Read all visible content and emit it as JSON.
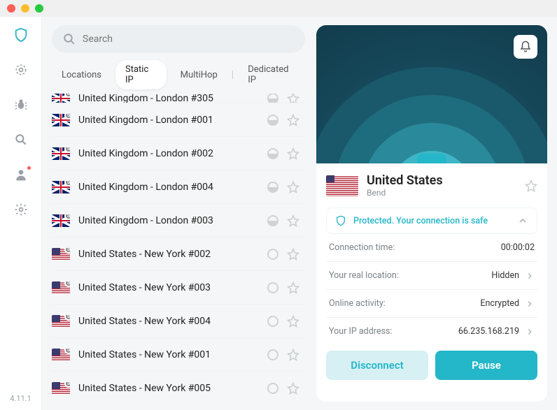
{
  "version": "4.11.1",
  "search": {
    "placeholder": "Search"
  },
  "tabs": {
    "items": [
      "Locations",
      "Static IP",
      "MultiHop",
      "Dedicated IP"
    ],
    "activeIndex": 1
  },
  "locations": [
    {
      "name": "United Kingdom - London #305",
      "flag": "uk",
      "load": "half",
      "cut": true
    },
    {
      "name": "United Kingdom - London #001",
      "flag": "uk",
      "load": "half"
    },
    {
      "name": "United Kingdom - London #002",
      "flag": "uk",
      "load": "half"
    },
    {
      "name": "United Kingdom - London #004",
      "flag": "uk",
      "load": "half"
    },
    {
      "name": "United Kingdom - London #003",
      "flag": "uk",
      "load": "half"
    },
    {
      "name": "United States - New York #002",
      "flag": "us",
      "load": "empty"
    },
    {
      "name": "United States - New York #003",
      "flag": "us",
      "load": "empty"
    },
    {
      "name": "United States - New York #004",
      "flag": "us",
      "load": "empty"
    },
    {
      "name": "United States - New York #001",
      "flag": "us",
      "load": "empty"
    },
    {
      "name": "United States - New York #005",
      "flag": "us",
      "load": "empty"
    }
  ],
  "current": {
    "country": "United States",
    "city": "Bend",
    "flag": "us"
  },
  "status": {
    "text": "Protected. Your connection is safe"
  },
  "details": [
    {
      "label": "Connection time:",
      "value": "00:00:02",
      "chevron": false
    },
    {
      "label": "Your real location:",
      "value": "Hidden",
      "chevron": true
    },
    {
      "label": "Online activity:",
      "value": "Encrypted",
      "chevron": true
    },
    {
      "label": "Your IP address:",
      "value": "66.235.168.219",
      "chevron": true
    }
  ],
  "buttons": {
    "disconnect": "Disconnect",
    "pause": "Pause"
  },
  "sidebarIcons": [
    "shield-icon",
    "radar-icon",
    "bug-icon",
    "search-alt-icon",
    "user-icon",
    "gear-icon"
  ]
}
